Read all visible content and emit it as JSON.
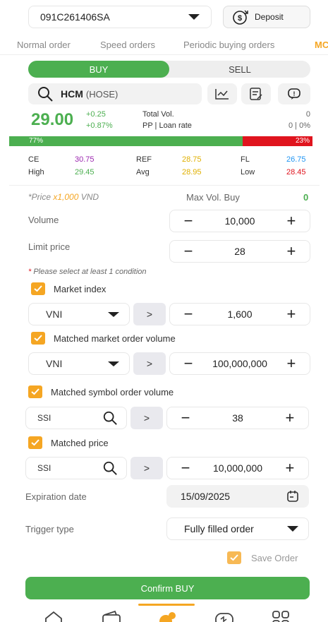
{
  "account": {
    "id": "091C261406SA"
  },
  "deposit_label": "Deposit",
  "tabs": [
    "Normal order",
    "Speed orders",
    "Periodic buying orders",
    "MC"
  ],
  "side": {
    "buy": "BUY",
    "sell": "SELL"
  },
  "symbol": {
    "code": "HCM",
    "exchange": "(HOSE)"
  },
  "price": {
    "last": "29.00",
    "change": "+0.25",
    "change_pct": "+0.87%"
  },
  "totals": {
    "total_vol_label": "Total Vol.",
    "total_vol_value": "0",
    "pp_label": "PP | Loan rate",
    "pp_value": "0 | 0%"
  },
  "ratio": {
    "buy": "77%",
    "sell": "23%",
    "buy_fraction": 0.77
  },
  "ref_prices": {
    "ce_label": "CE",
    "ce": "30.75",
    "ref_label": "REF",
    "ref": "28.75",
    "fl_label": "FL",
    "fl": "26.75",
    "high_label": "High",
    "high": "29.45",
    "avg_label": "Avg",
    "avg": "28.95",
    "low_label": "Low",
    "low": "28.45"
  },
  "price_unit": {
    "prefix": "*Price ",
    "mult": "x1,000",
    "suffix": " VND"
  },
  "max_vol": {
    "label": "Max Vol. Buy",
    "value": "0"
  },
  "volume": {
    "label": "Volume",
    "value": "10,000"
  },
  "limit_price": {
    "label": "Limit price",
    "value": "28"
  },
  "condition_note": {
    "star": "*",
    "text": " Please select at least 1 condition"
  },
  "conditions": {
    "market_index": {
      "label": "Market index",
      "select": "VNI",
      "op": ">",
      "value": "1,600"
    },
    "matched_market_vol": {
      "label": "Matched market order volume",
      "select": "VNI",
      "op": ">",
      "value": "100,000,000"
    },
    "matched_symbol_vol": {
      "label": "Matched symbol order volume",
      "symbol": "SSI",
      "op": ">",
      "value": "38"
    },
    "matched_price": {
      "label": "Matched price",
      "symbol": "SSI",
      "op": ">",
      "value": "10,000,000"
    }
  },
  "expiration": {
    "label": "Expiration date",
    "value": "15/09/2025"
  },
  "trigger": {
    "label": "Trigger type",
    "value": "Fully filled order"
  },
  "save_order": "Save Order",
  "confirm": "Confirm BUY",
  "colors": {
    "green": "#4caf50",
    "red": "#e53935",
    "ceiling": "#9c27b0",
    "floor": "#2196f3",
    "ref": "#e0b000",
    "orange": "#f5a623"
  }
}
